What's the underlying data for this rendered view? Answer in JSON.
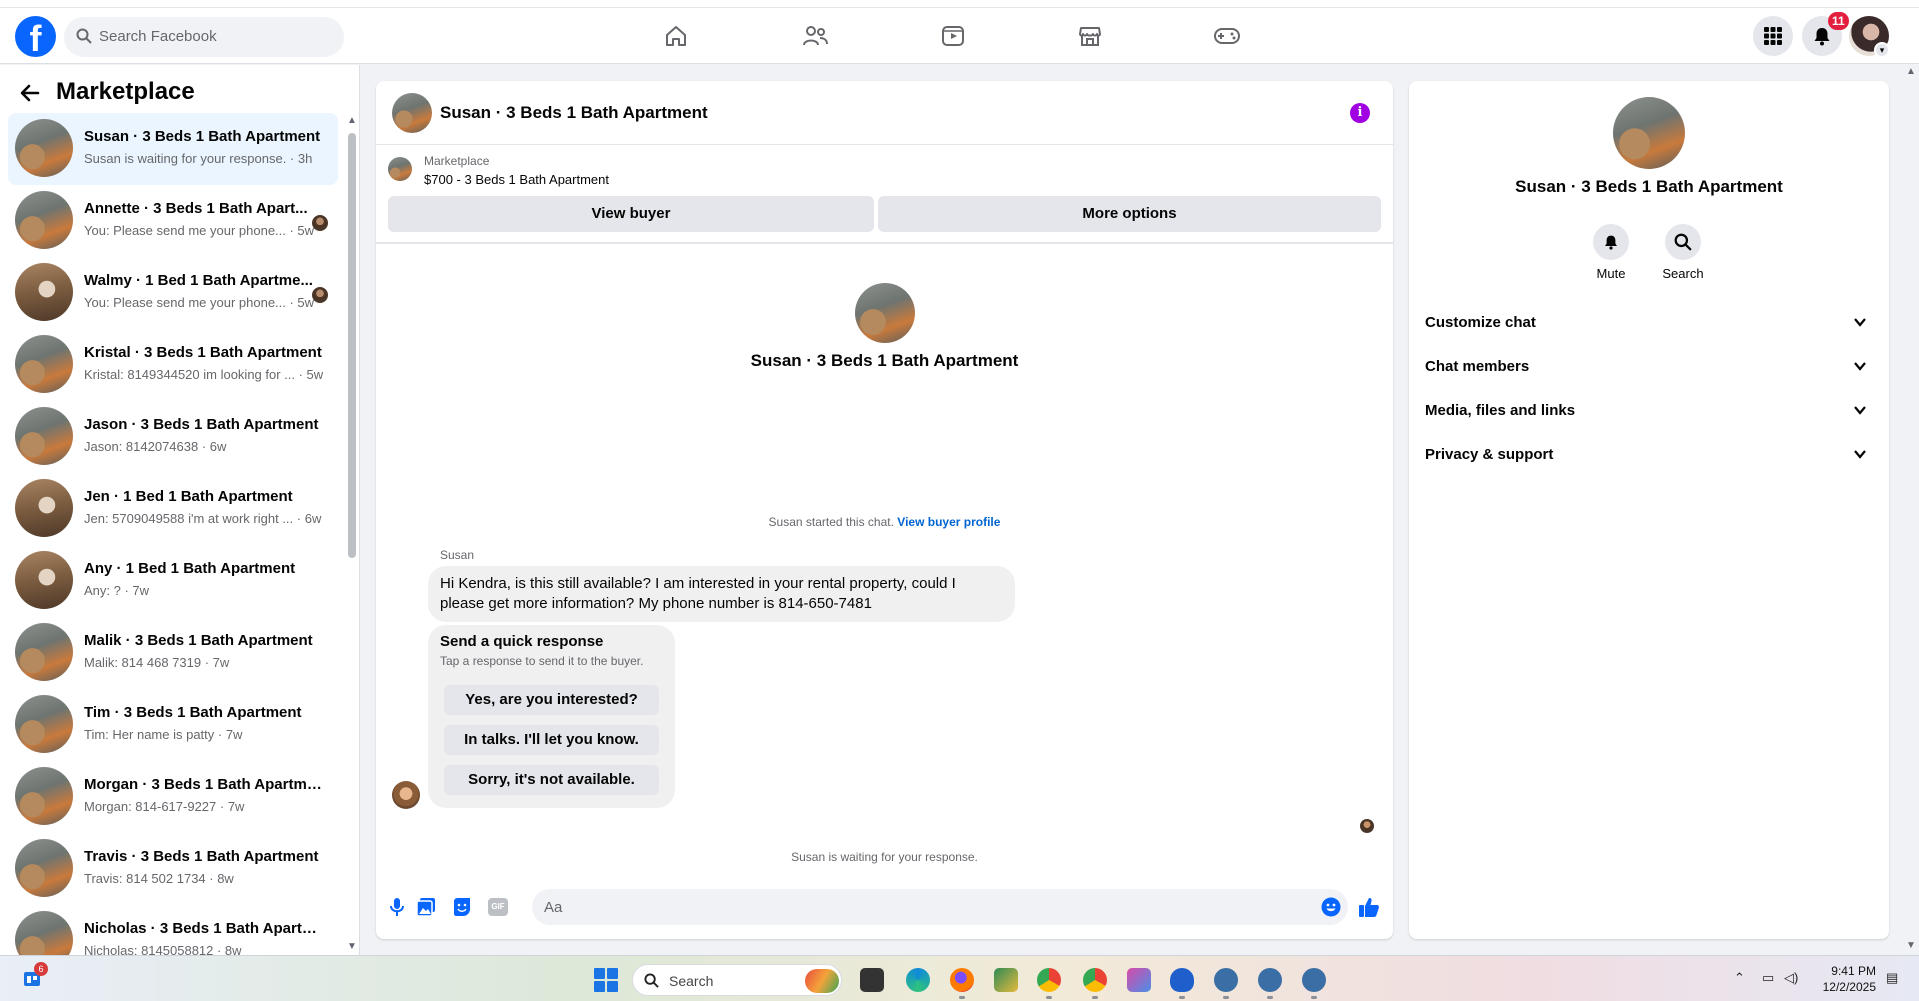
{
  "header": {
    "search_placeholder": "Search Facebook",
    "notification_count": "11"
  },
  "sidebar": {
    "title": "Marketplace",
    "conversations": [
      {
        "name": "Susan · 3 Beds 1 Bath Apartment",
        "preview": "Susan is waiting for your response. · 3h",
        "avatar": "room",
        "active": true
      },
      {
        "name": "Annette · 3 Beds 1 Bath Apart...",
        "preview": "You: Please send me your phone... · 5w",
        "avatar": "room"
      },
      {
        "name": "Walmy · 1 Bed 1 Bath Apartme...",
        "preview": "You: Please send me your phone... · 5w",
        "avatar": "wood"
      },
      {
        "name": "Kristal · 3 Beds 1 Bath Apartment",
        "preview": "Kristal: 8149344520 im looking for ... · 5w",
        "avatar": "room"
      },
      {
        "name": "Jason · 3 Beds 1 Bath Apartment",
        "preview": "Jason: 8142074638 · 6w",
        "avatar": "room"
      },
      {
        "name": "Jen · 1 Bed 1 Bath Apartment",
        "preview": "Jen: 5709049588 i'm at work right ... · 6w",
        "avatar": "wood"
      },
      {
        "name": "Any · 1 Bed 1 Bath Apartment",
        "preview": "Any: ? · 7w",
        "avatar": "wood"
      },
      {
        "name": "Malik · 3 Beds 1 Bath Apartment",
        "preview": "Malik: 814 468 7319 · 7w",
        "avatar": "room"
      },
      {
        "name": "Tim · 3 Beds 1 Bath Apartment",
        "preview": "Tim: Her name is patty · 7w",
        "avatar": "room"
      },
      {
        "name": "Morgan · 3 Beds 1 Bath Apartme...",
        "preview": "Morgan: 814-617-9227 · 7w",
        "avatar": "room"
      },
      {
        "name": "Travis · 3 Beds 1 Bath Apartment",
        "preview": "Travis: 814 502 1734 · 8w",
        "avatar": "room"
      },
      {
        "name": "Nicholas · 3 Beds 1 Bath Apartm...",
        "preview": "Nicholas: 8145058812 · 8w",
        "avatar": "room"
      }
    ]
  },
  "chat": {
    "title": "Susan · 3 Beds 1 Bath Apartment",
    "listing_source": "Marketplace",
    "listing_price": "$700 - 3 Beds 1 Bath Apartment",
    "view_buyer": "View buyer",
    "more_options": "More options",
    "intro_name": "Susan · 3 Beds 1 Bath Apartment",
    "started_text": "Susan started this chat.",
    "view_profile": "View buyer profile",
    "sender": "Susan",
    "message": "Hi Kendra, is this still available? I am interested in your rental property, could I please get more information? My phone number is 814-650-7481",
    "quick_title": "Send a quick response",
    "quick_sub": "Tap a response to send it to the buyer.",
    "quick_options": [
      "Yes, are you interested?",
      "In talks. I'll let you know.",
      "Sorry, it's not available."
    ],
    "waiting": "Susan is waiting for your response.",
    "input_placeholder": "Aa",
    "gif_label": "GIF"
  },
  "details": {
    "name": "Susan · 3 Beds 1 Bath Apartment",
    "mute": "Mute",
    "search": "Search",
    "sections": [
      "Customize chat",
      "Chat members",
      "Media, files and links",
      "Privacy & support"
    ]
  },
  "taskbar": {
    "search": "Search",
    "widget_badge": "6",
    "time": "9:41 PM",
    "date": "12/2/2025"
  },
  "colors": {
    "brand": "#0866ff",
    "accent": "#0064d1",
    "info": "#a100e0",
    "badge": "#e41e3f"
  }
}
